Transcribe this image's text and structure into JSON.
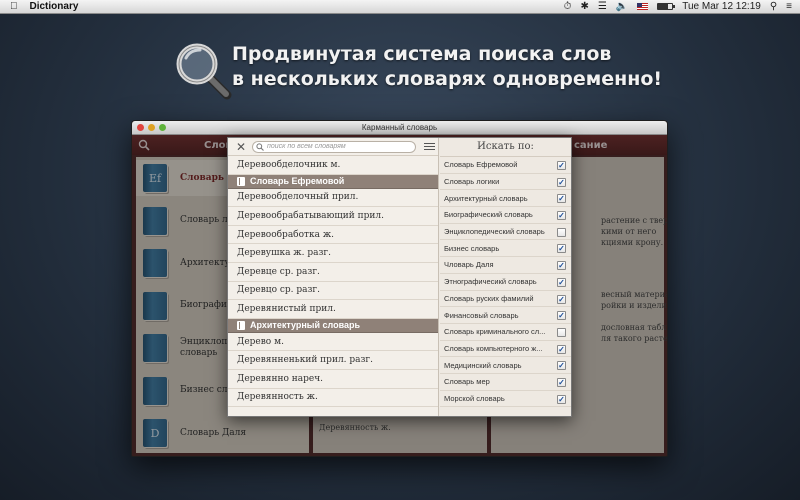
{
  "menubar": {
    "app_name": "Dictionary",
    "clock": "Tue Mar 12  12:19"
  },
  "headline": {
    "line1": "Продвинутая система поиска слов",
    "line2": "в нескольких словарях одновременно!"
  },
  "window": {
    "title": "Карманный словарь",
    "toolbar_left_title": "Слов",
    "toolbar_right_title": "сание"
  },
  "dictionaries": [
    {
      "icon": "Ef",
      "label": "Словарь Ефр",
      "selected": true
    },
    {
      "icon": "",
      "label": "Словарь лог",
      "selected": false
    },
    {
      "icon": "",
      "label": "Архитекту",
      "selected": false
    },
    {
      "icon": "",
      "label": "Биографи",
      "selected": false
    },
    {
      "icon": "",
      "label": "Энциклопе\nсловарь",
      "selected": false
    },
    {
      "icon": "",
      "label": "Бизнес слов",
      "selected": false
    },
    {
      "icon": "D",
      "label": "Словарь Даля",
      "selected": false
    }
  ],
  "background_text": {
    "mid_bottom": "Деревянность ж.",
    "right_1": "растение с твердым\nкими от него\nкциями крону.",
    "right_2": "весный материал,\nройки и изделия.",
    "right_3": "дословная таблица,\nля такого растения;"
  },
  "popup": {
    "search_placeholder": "поиск по всем словарям",
    "filter_title": "Искать по:",
    "words": [
      {
        "type": "word",
        "text": "Деревообделочник м."
      },
      {
        "type": "header",
        "text": "Словарь Ефремовой"
      },
      {
        "type": "word",
        "text": "Деревообделочный прил."
      },
      {
        "type": "word",
        "text": "Деревообрабатывающий прил."
      },
      {
        "type": "word",
        "text": "Деревообработка ж."
      },
      {
        "type": "word",
        "text": "Деревушка ж. разг."
      },
      {
        "type": "word",
        "text": "Деревце ср. разг."
      },
      {
        "type": "word",
        "text": "Деревцо ср. разг."
      },
      {
        "type": "word",
        "text": "Деревянистый прил."
      },
      {
        "type": "header",
        "text": "Архитектурный словарь"
      },
      {
        "type": "word",
        "text": "Дерево м."
      },
      {
        "type": "word",
        "text": "Деревянненький прил. разг."
      },
      {
        "type": "word",
        "text": "Деревянно нареч."
      },
      {
        "type": "word",
        "text": "Деревянность ж."
      }
    ],
    "filters": [
      {
        "label": "Словарь Ефремовой",
        "checked": true
      },
      {
        "label": "Словарь логики",
        "checked": true
      },
      {
        "label": "Архитектурный словарь",
        "checked": true
      },
      {
        "label": "Биографический словарь",
        "checked": true
      },
      {
        "label": "Энциклопедический словарь",
        "checked": false
      },
      {
        "label": "Бизнес словарь",
        "checked": true
      },
      {
        "label": "Чловарь Даля",
        "checked": true
      },
      {
        "label": "Этнографичесикй словарь",
        "checked": true
      },
      {
        "label": "Словарь руских фамилий",
        "checked": true
      },
      {
        "label": "Финансовый словарь",
        "checked": true
      },
      {
        "label": "Словарь криминального сл...",
        "checked": false
      },
      {
        "label": "Словарь компьютерного ж...",
        "checked": true
      },
      {
        "label": "Медицинский словарь",
        "checked": true
      },
      {
        "label": "Словарь мер",
        "checked": true
      },
      {
        "label": "Морской словарь",
        "checked": true
      }
    ],
    "check_glyph": "✓"
  }
}
